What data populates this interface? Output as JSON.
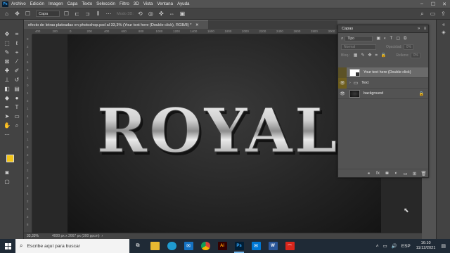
{
  "menubar": {
    "app_badge": "Ps",
    "items": [
      "Archivo",
      "Edición",
      "Imagen",
      "Capa",
      "Texto",
      "Selección",
      "Filtro",
      "3D",
      "Vista",
      "Ventana",
      "Ayuda"
    ],
    "window_controls": [
      "–",
      "☐",
      "✕"
    ]
  },
  "optionsbar": {
    "layer_select": "Capa",
    "mode3d": "Modo 3D:"
  },
  "document": {
    "tab_title": "efecto de letras plateadas en photoshop.psd al 33,3% (Your text here (Double click), RGB/8) *",
    "tab_close": "✕",
    "canvas_text": "ROYAL",
    "ruler_h": [
      "400",
      "200",
      "0",
      "200",
      "400",
      "600",
      "800",
      "1000",
      "1200",
      "1400",
      "1600",
      "1800",
      "2000",
      "2200",
      "2400",
      "2600",
      "2800",
      "3000"
    ],
    "ruler_v": [
      "0",
      "2",
      "4",
      "6",
      "8",
      "1",
      "0",
      "1",
      "2",
      "1",
      "4",
      "1",
      "6",
      "1",
      "8",
      "2",
      "0",
      "2",
      "2",
      "2",
      "4",
      "2",
      "6",
      "2",
      "8"
    ]
  },
  "status": {
    "zoom": "33,33%",
    "doc_size": "4000 px x 2667 px (300 ppcm)"
  },
  "layers_panel": {
    "title": "Capas",
    "filter": "Tipo",
    "blend": "Normal",
    "opacity_label": "Opacidad:",
    "opacity_value": "0%",
    "lock_label": "Bloq.:",
    "fill_label": "Relleno:",
    "fill_value": "0%",
    "layers": [
      {
        "name": "Your text here (Double click)",
        "visible": true,
        "selected": true
      },
      {
        "name": "Text",
        "visible": false,
        "selected": false
      },
      {
        "name": "background",
        "visible": true,
        "selected": false,
        "locked": true
      }
    ]
  },
  "taskbar": {
    "search_placeholder": "Escribe aquí para buscar",
    "apps": [
      "task-view",
      "file-explorer",
      "edge",
      "mail",
      "chrome",
      "illustrator",
      "photoshop",
      "mail-app",
      "word",
      "acrobat"
    ],
    "lang": "ESP",
    "time": "16:10",
    "date": "11/12/2021"
  },
  "colors": {
    "foreground": "#f2c418",
    "background": "#1a1a1a",
    "accent": "#31a8ff",
    "layer_selected": "#5a5a5a"
  }
}
